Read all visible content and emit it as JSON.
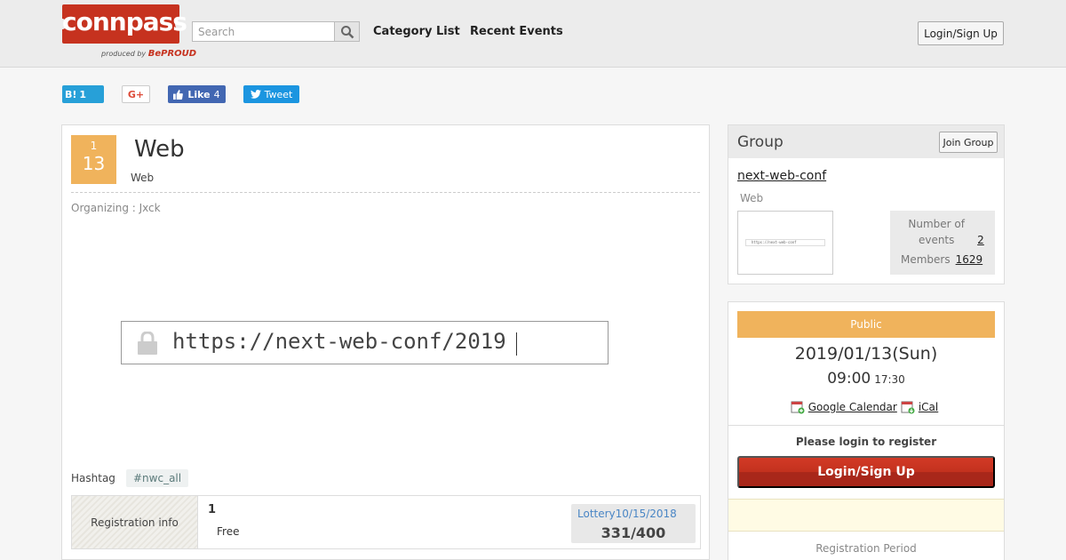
{
  "header": {
    "logo_text": "connpass",
    "logo_sub_prefix": "produced by",
    "logo_sub_brand": "BePROUD",
    "search_placeholder": "Search",
    "nav": {
      "category": "Category List",
      "recent": "Recent Events"
    },
    "login_label": "Login/Sign Up"
  },
  "social": {
    "hatena_label": "B!",
    "hatena_count": "1",
    "google_label": "G+",
    "like_label": "Like",
    "like_count": "4",
    "tweet_label": "Tweet"
  },
  "event": {
    "month": "1",
    "day": "13",
    "title": "Web",
    "subtitle": "Web",
    "organizer": "Organizing : Jxck",
    "image_url": "https://next-web-conf/2019",
    "hashtag_label": "Hashtag",
    "hashtag": "#nwc_all",
    "registration": {
      "label": "Registration info",
      "name": "1",
      "price": "Free",
      "lottery": "Lottery10/15/2018",
      "count": "331/400"
    }
  },
  "group": {
    "heading": "Group",
    "join_label": "Join Group",
    "name": "next-web-conf",
    "description": "Web",
    "thumb_url": "https://next-web-conf",
    "events_label": "Number of events",
    "events_count": "2",
    "members_label": "Members",
    "members_count": "1629"
  },
  "event_info": {
    "visibility": "Public",
    "date": "2019/01/13(Sun)",
    "start_time": "09:00",
    "end_time": "17:30",
    "google_calendar": "Google Calendar",
    "ical": "iCal",
    "please_login": "Please login to register",
    "login_button": "Login/Sign Up",
    "reg_period_label": "Registration Period"
  },
  "colors": {
    "brand_red": "#c6321f",
    "accent_orange": "#f0b35c",
    "hatena_blue": "#27a0d8",
    "facebook_blue": "#4267b2",
    "twitter_blue": "#1b95e0"
  }
}
